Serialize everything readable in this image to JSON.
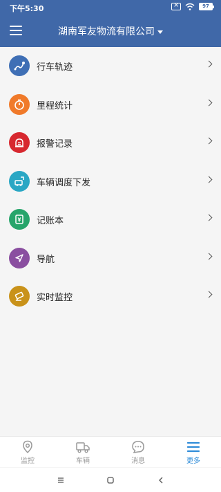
{
  "status_bar": {
    "time": "下午5:30",
    "battery": "97"
  },
  "header": {
    "title": "湖南军友物流有限公司"
  },
  "menu": [
    {
      "label": "行车轨迹",
      "icon": "route-icon",
      "color": "#3f6fb5"
    },
    {
      "label": "里程统计",
      "icon": "timer-icon",
      "color": "#f07a2a"
    },
    {
      "label": "报警记录",
      "icon": "alarm-icon",
      "color": "#d7282f"
    },
    {
      "label": "车辆调度下发",
      "icon": "dispatch-icon",
      "color": "#2aa7c4"
    },
    {
      "label": "记账本",
      "icon": "ledger-icon",
      "color": "#27a56b"
    },
    {
      "label": "导航",
      "icon": "navigation-icon",
      "color": "#8a4ea0"
    },
    {
      "label": "实时监控",
      "icon": "camera-icon",
      "color": "#c9921a"
    }
  ],
  "tabs": [
    {
      "label": "监控",
      "icon": "location-pin-icon",
      "active": false
    },
    {
      "label": "车辆",
      "icon": "truck-icon",
      "active": false
    },
    {
      "label": "消息",
      "icon": "chat-bubble-icon",
      "active": false
    },
    {
      "label": "更多",
      "icon": "more-list-icon",
      "active": true
    }
  ],
  "colors": {
    "primary": "#4068a8",
    "tab_active": "#2f8cd8",
    "tab_inactive": "#999999"
  }
}
